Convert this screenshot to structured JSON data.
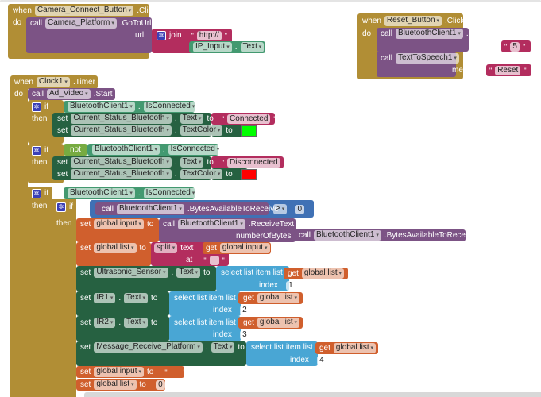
{
  "colors": {
    "event": "#b18e35",
    "procedure_call": "#7c5385",
    "text": "#b32d5e",
    "component_get": "#439970",
    "component_set": "#266141",
    "logic": "#77ab41",
    "math": "#3f71b5",
    "list": "#49a6d4",
    "variable": "#d05f2d",
    "color_green": "#00ff00",
    "color_red": "#ff0000"
  },
  "kw": {
    "when": "when",
    "do": "do",
    "call": "call",
    "if": "if",
    "then": "then",
    "set": "set",
    "to": "to",
    "get": "get",
    "not": "not",
    "dot": ".",
    "url": "url",
    "join": "join",
    "text": "text",
    "message": "message",
    "numberOfBytes": "numberOfBytes",
    "split": "split",
    "at": "at",
    "select": "select list item  list",
    "index": "index"
  },
  "camera": {
    "component": "Camera_Connect_Button",
    "event": ".Click",
    "target": "Camera_Platform",
    "method": ".GoToUrl",
    "literal": "http://",
    "getter_comp": "IP_Input",
    "getter_prop": "Text"
  },
  "reset": {
    "component": "Reset_Button",
    "event": ".Click",
    "bt": "BluetoothClient1",
    "send": ".SendText",
    "send_val": "5",
    "tts": "TextToSpeech1",
    "speak": ".Speak",
    "speak_val": "Reset"
  },
  "clock": {
    "component": "Clock1",
    "event": ".Timer",
    "video": "Ad_Video",
    "start": ".Start",
    "bt": "BluetoothClient1",
    "connected": "IsConnected",
    "status": "Current_Status_Bluetooth",
    "text_prop": "Text",
    "color_prop": "TextColor",
    "connected_text": "Connected",
    "disconnected_text": "Disconnected",
    "bytes": ".BytesAvailableToReceive",
    "compare_op": ">",
    "zero": "0",
    "receive": ".ReceiveText",
    "global_input": "global input",
    "global_list": "global list",
    "split_at": "|",
    "ultrasonic": "Ultrasonic_Sensor",
    "ir1": "IR1",
    "ir2": "IR2",
    "msg": "Message_Receive_Platform",
    "i1": "1",
    "i2": "2",
    "i3": "3",
    "i4": "4",
    "empty": "",
    "reset_list": "0"
  }
}
